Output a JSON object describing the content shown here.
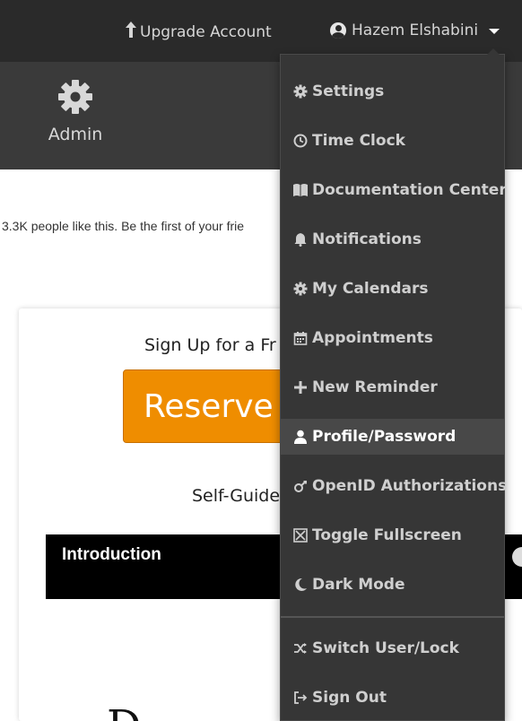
{
  "header": {
    "upgrade_label": "Upgrade Account",
    "user_name": "Hazem Elshabini"
  },
  "subnav": {
    "admin_label": "Admin"
  },
  "facebook_text": "3.3K people like this. Be the first of your frie",
  "card": {
    "signup_text": "Sign Up for a Fr",
    "reserve_label": "Reserve F",
    "selfguided_text": "Self-Guide",
    "video_title": "Introduction",
    "video_glyph": "D"
  },
  "menu": {
    "items": [
      {
        "label": "Settings",
        "icon": "gear-icon"
      },
      {
        "label": "Time Clock",
        "icon": "clock-icon"
      },
      {
        "label": "Documentation Center",
        "icon": "book-icon"
      },
      {
        "label": "Notifications",
        "icon": "bell-icon"
      },
      {
        "label": "My Calendars",
        "icon": "gear-icon"
      },
      {
        "label": "Appointments",
        "icon": "calendar-icon"
      },
      {
        "label": "New Reminder",
        "icon": "plus-icon"
      },
      {
        "label": "Profile/Password",
        "icon": "user-icon",
        "active": true
      },
      {
        "label": "OpenID Authorizations",
        "icon": "openid-icon"
      },
      {
        "label": "Toggle Fullscreen",
        "icon": "fullscreen-icon"
      },
      {
        "label": "Dark Mode",
        "icon": "moon-icon"
      },
      {
        "label": "Switch User/Lock",
        "icon": "shuffle-icon"
      },
      {
        "label": "Sign Out",
        "icon": "sign-out-icon"
      }
    ]
  },
  "colors": {
    "topbar": "#2a2a2a",
    "subbar": "#3a3a3a",
    "menu_bg": "#363636",
    "menu_active": "#484848",
    "accent_orange": "#ef8d00"
  }
}
